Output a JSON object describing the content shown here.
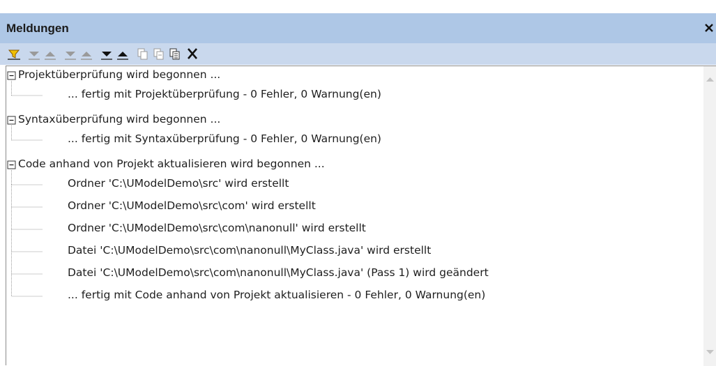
{
  "panel": {
    "title": "Meldungen"
  },
  "toolbar": {
    "buttons": [
      "filter-icon",
      "next-error-icon",
      "prev-error-icon",
      "next-warning-icon",
      "prev-warning-icon",
      "next-message-icon",
      "prev-message-icon",
      "copy-line-icon",
      "copy-branch-icon",
      "copy-all-icon",
      "clear-icon"
    ]
  },
  "messages": [
    {
      "text": "Projektüberprüfung wird begonnen ...",
      "level": 0
    },
    {
      "text": "... fertig mit Projektüberprüfung - 0 Fehler, 0 Warnung(en)",
      "level": 1
    },
    {
      "text": "Syntaxüberprüfung wird begonnen ...",
      "level": 0
    },
    {
      "text": "... fertig mit Syntaxüberprüfung - 0 Fehler, 0 Warnung(en)",
      "level": 1
    },
    {
      "text": "Code anhand von Projekt aktualisieren wird begonnen ...",
      "level": 0
    },
    {
      "text": "Ordner 'C:\\UModelDemo\\src' wird erstellt",
      "level": 1
    },
    {
      "text": "Ordner 'C:\\UModelDemo\\src\\com' wird erstellt",
      "level": 1
    },
    {
      "text": "Ordner 'C:\\UModelDemo\\src\\com\\nanonull' wird erstellt",
      "level": 1
    },
    {
      "text": "Datei 'C:\\UModelDemo\\src\\com\\nanonull\\MyClass.java' wird erstellt",
      "level": 1
    },
    {
      "text": "Datei 'C:\\UModelDemo\\src\\com\\nanonull\\MyClass.java' (Pass 1) wird geändert",
      "level": 1
    },
    {
      "text": "... fertig mit Code anhand von Projekt aktualisieren - 0 Fehler, 0 Warnung(en)",
      "level": 1
    }
  ]
}
